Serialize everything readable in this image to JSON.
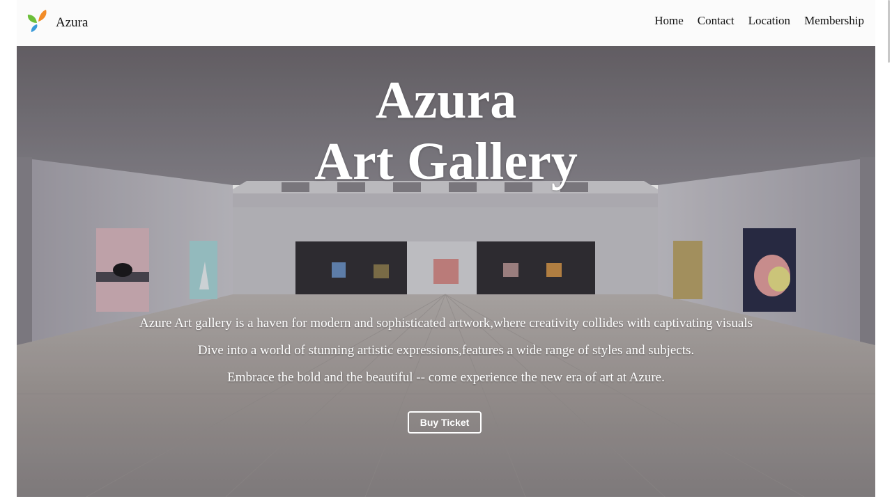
{
  "brand": {
    "name": "Azura",
    "logo": "butterfly-logo-icon"
  },
  "nav": {
    "items": [
      {
        "label": "Home"
      },
      {
        "label": "Contact"
      },
      {
        "label": "Location"
      },
      {
        "label": "Membership"
      }
    ]
  },
  "hero": {
    "title_line1": "Azura",
    "title_line2": "Art Gallery",
    "lines": [
      "Azure Art gallery is a haven for modern and sophisticated artwork,where creativity collides with captivating visuals",
      "Dive into a world of stunning artistic expressions,features a wide range of styles and subjects.",
      "Embrace the bold and the beautiful -- come experience the new era of art at Azure."
    ],
    "button_label": "Buy Ticket",
    "background": "gallery-interior-image"
  },
  "colors": {
    "navbar_bg": "#fbfbfb",
    "logo_green": "#6cbf3a",
    "logo_orange": "#f28c28",
    "logo_blue": "#3a9ad9",
    "hero_text": "#ffffff"
  }
}
